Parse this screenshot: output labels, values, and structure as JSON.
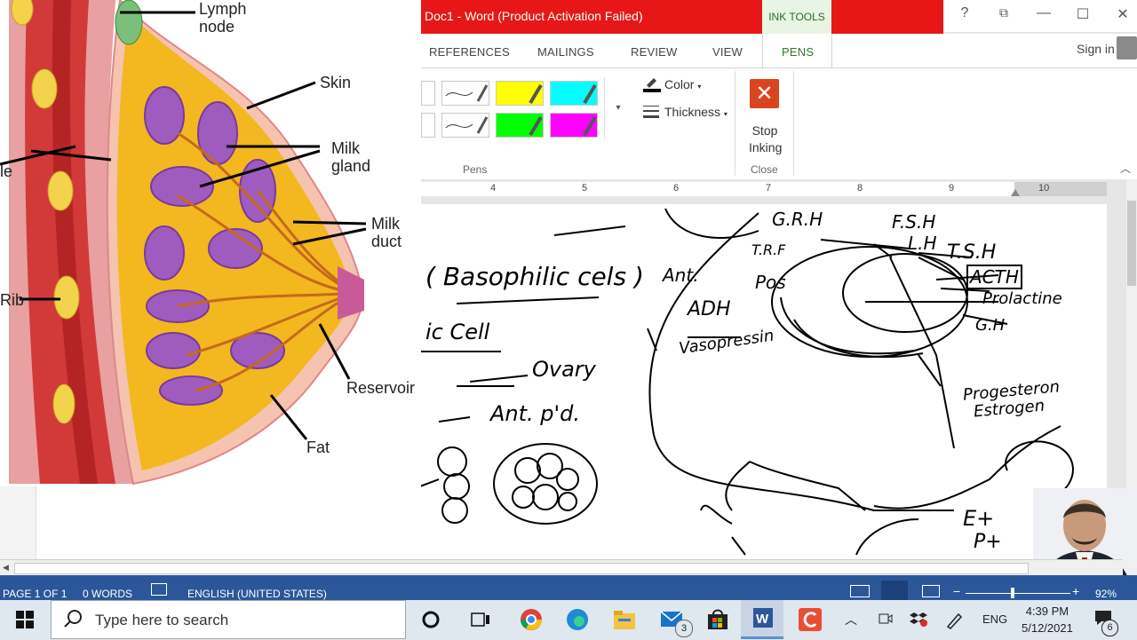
{
  "window": {
    "title": "Doc1 - Word (Product Activation Failed)",
    "context_tab": "INK TOOLS",
    "controls": {
      "help": "?",
      "restore_ribbon": "⧉",
      "minimize": "—",
      "maximize": "☐",
      "close": "✕"
    }
  },
  "tabs": [
    {
      "label": "REFERENCES"
    },
    {
      "label": "MAILINGS"
    },
    {
      "label": "REVIEW"
    },
    {
      "label": "VIEW"
    },
    {
      "label": "PENS",
      "active": true
    }
  ],
  "account": {
    "sign_in": "Sign in"
  },
  "ribbon": {
    "pens_group_label": "Pens",
    "color_label": "Color",
    "thickness_label": "Thickness",
    "stop_inking_line1": "Stop",
    "stop_inking_line2": "Inking",
    "close_group_label": "Close",
    "pen_colors": [
      "#ffffff",
      "#ffffff",
      "#ffff00",
      "#00ffff",
      "#ffffff",
      "#ffffff",
      "#00ff00",
      "#ff00ff"
    ]
  },
  "ruler": {
    "numbers": [
      "4",
      "5",
      "6",
      "7",
      "8",
      "9",
      "10"
    ]
  },
  "anatomy_labels": {
    "lymph_node": "Lymph node",
    "skin": "Skin",
    "milk_gland": "Milk gland",
    "milk_duct": "Milk duct",
    "muscle": "le",
    "rib": "Rib",
    "reservoir": "Reservoir",
    "fat": "Fat"
  },
  "ink_text": {
    "basophilic": "( Basophilic cels )",
    "cell": "ic  Cell",
    "ovary": "Ovary",
    "ant_pit": "Ant. p'd.",
    "ant": "Ant.",
    "pos": "Pos",
    "adh": "ADH",
    "vasopressin": "Vasopressin",
    "grh": "G.R.H",
    "trf": "T.R.F",
    "fsh": "F.S.H",
    "lh": "L.H",
    "tsh": "T.S.H",
    "acth": "ACTH",
    "prolactine": "Prolactine",
    "gh": "G.H",
    "progesterone": "Progesteron",
    "estrogen": "Estrogen",
    "e_plus": "E+",
    "p_plus": "P+"
  },
  "status_bar": {
    "page": "PAGE 1 OF 1",
    "words": "0 WORDS",
    "language": "ENGLISH (UNITED STATES)",
    "zoom": "92%"
  },
  "taskbar": {
    "search_placeholder": "Type here to search",
    "language": "ENG",
    "time": "4:39 PM",
    "date": "5/12/2021",
    "mail_badge": "3",
    "notifications_badge": "6"
  }
}
